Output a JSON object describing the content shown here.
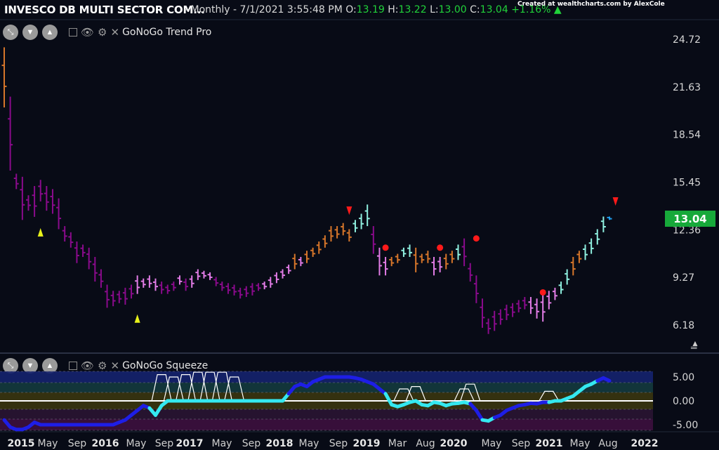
{
  "header": {
    "symbol_title": "INVESCO DB MULTI SECTOR COM...",
    "period": "- Monthly - 7/1/2021 3:55:48 PM",
    "ohlc": [
      {
        "label": "O:",
        "value": "13.19"
      },
      {
        "label": "H:",
        "value": "13.22"
      },
      {
        "label": "L:",
        "value": "13.00"
      },
      {
        "label": "C:",
        "value": "13.04"
      }
    ],
    "change": "+1.16%",
    "credit": "Created at wealthcharts.com by AlexCole"
  },
  "panels": {
    "trend": {
      "name": "GoNoGo Trend Pro"
    },
    "squeeze": {
      "name": "GoNoGo Squeeze"
    }
  },
  "icons": {
    "expand": "diagonal-arrows-icon",
    "down": "triangle-down-icon",
    "up": "triangle-up-icon",
    "visibility": "eye-icon",
    "settings": "gear-icon",
    "remove": "close-icon"
  },
  "colors": {
    "background": "#080b16",
    "nogo_strong": "#8a0b8c",
    "nogo_weak": "#e27ce6",
    "go_strong": "#d7762a",
    "go_weak": "#8ff0e0",
    "go_bright": "#1f9ff0",
    "signal_up": "#e8f21a",
    "signal_down": "#ff1a1a",
    "price_tag": "#17a93a"
  },
  "price_tag": "13.04",
  "chart_data": [
    {
      "type": "bar",
      "title": "GoNoGo Trend Pro",
      "y_ticks": [
        "24.72",
        "21.63",
        "18.54",
        "15.45",
        "12.36",
        "9.27",
        "6.18"
      ],
      "ylim": [
        4.2,
        26.7
      ],
      "x_ticks": [
        {
          "label": "2015",
          "bold": true
        },
        {
          "label": "May"
        },
        {
          "label": "Sep"
        },
        {
          "label": "2016",
          "bold": true
        },
        {
          "label": "May"
        },
        {
          "label": "Sep"
        },
        {
          "label": "2017",
          "bold": true
        },
        {
          "label": "May"
        },
        {
          "label": "Sep"
        },
        {
          "label": "2018",
          "bold": true
        },
        {
          "label": "May"
        },
        {
          "label": "Sep"
        },
        {
          "label": "2019",
          "bold": true
        },
        {
          "label": "Mar"
        },
        {
          "label": "Aug"
        },
        {
          "label": "2020",
          "bold": true
        },
        {
          "label": "May"
        },
        {
          "label": "Sep"
        },
        {
          "label": "2021",
          "bold": true
        },
        {
          "label": "May"
        },
        {
          "label": "Aug"
        },
        {
          "label": "2022",
          "bold": true
        }
      ],
      "x_range_months": [
        0,
        90
      ],
      "ohlc_bars": [
        {
          "m": 0,
          "h": 24.2,
          "l": 20.3,
          "c": "gs"
        },
        {
          "m": 1,
          "h": 21.0,
          "l": 16.2,
          "c": "ns"
        },
        {
          "m": 2,
          "h": 16.0,
          "l": 15.0,
          "c": "ns"
        },
        {
          "m": 3,
          "h": 15.8,
          "l": 13.0,
          "c": "ns"
        },
        {
          "m": 4,
          "h": 14.6,
          "l": 13.6,
          "c": "ns"
        },
        {
          "m": 5,
          "h": 15.2,
          "l": 13.2,
          "c": "ns"
        },
        {
          "m": 6,
          "h": 15.6,
          "l": 14.2,
          "c": "ns"
        },
        {
          "m": 7,
          "h": 15.2,
          "l": 13.6,
          "c": "ns"
        },
        {
          "m": 8,
          "h": 15.0,
          "l": 13.4,
          "c": "ns"
        },
        {
          "m": 9,
          "h": 14.4,
          "l": 12.4,
          "c": "ns"
        },
        {
          "m": 10,
          "h": 12.6,
          "l": 11.6,
          "c": "ns"
        },
        {
          "m": 11,
          "h": 12.2,
          "l": 11.2,
          "c": "ns"
        },
        {
          "m": 12,
          "h": 11.6,
          "l": 10.2,
          "c": "ns"
        },
        {
          "m": 13,
          "h": 11.4,
          "l": 10.6,
          "c": "ns"
        },
        {
          "m": 14,
          "h": 11.2,
          "l": 9.8,
          "c": "ns"
        },
        {
          "m": 15,
          "h": 10.6,
          "l": 9.0,
          "c": "ns"
        },
        {
          "m": 16,
          "h": 9.8,
          "l": 8.6,
          "c": "ns"
        },
        {
          "m": 17,
          "h": 8.8,
          "l": 7.3,
          "c": "ns"
        },
        {
          "m": 18,
          "h": 8.4,
          "l": 7.4,
          "c": "ns"
        },
        {
          "m": 19,
          "h": 8.4,
          "l": 7.6,
          "c": "ns"
        },
        {
          "m": 20,
          "h": 8.6,
          "l": 7.5,
          "c": "ns"
        },
        {
          "m": 21,
          "h": 8.8,
          "l": 7.9,
          "c": "ns"
        },
        {
          "m": 22,
          "h": 9.4,
          "l": 8.2,
          "c": "nw"
        },
        {
          "m": 23,
          "h": 9.2,
          "l": 8.6,
          "c": "nw"
        },
        {
          "m": 24,
          "h": 9.4,
          "l": 8.6,
          "c": "nw"
        },
        {
          "m": 25,
          "h": 9.2,
          "l": 8.4,
          "c": "nw"
        },
        {
          "m": 26,
          "h": 9.0,
          "l": 8.2,
          "c": "ns"
        },
        {
          "m": 27,
          "h": 8.8,
          "l": 8.2,
          "c": "ns"
        },
        {
          "m": 28,
          "h": 9.0,
          "l": 8.4,
          "c": "ns"
        },
        {
          "m": 29,
          "h": 9.4,
          "l": 8.8,
          "c": "nw"
        },
        {
          "m": 30,
          "h": 9.2,
          "l": 8.4,
          "c": "ns"
        },
        {
          "m": 31,
          "h": 9.4,
          "l": 8.6,
          "c": "nw"
        },
        {
          "m": 32,
          "h": 9.8,
          "l": 9.1,
          "c": "nw"
        },
        {
          "m": 33,
          "h": 9.7,
          "l": 9.2,
          "c": "nw"
        },
        {
          "m": 34,
          "h": 9.6,
          "l": 9.1,
          "c": "nw"
        },
        {
          "m": 35,
          "h": 9.3,
          "l": 8.7,
          "c": "ns"
        },
        {
          "m": 36,
          "h": 9.0,
          "l": 8.4,
          "c": "ns"
        },
        {
          "m": 37,
          "h": 8.9,
          "l": 8.2,
          "c": "ns"
        },
        {
          "m": 38,
          "h": 8.8,
          "l": 8.1,
          "c": "ns"
        },
        {
          "m": 39,
          "h": 8.6,
          "l": 7.9,
          "c": "ns"
        },
        {
          "m": 40,
          "h": 8.7,
          "l": 8.0,
          "c": "ns"
        },
        {
          "m": 41,
          "h": 8.9,
          "l": 8.1,
          "c": "ns"
        },
        {
          "m": 42,
          "h": 8.9,
          "l": 8.4,
          "c": "ns"
        },
        {
          "m": 43,
          "h": 9.0,
          "l": 8.5,
          "c": "nw"
        },
        {
          "m": 44,
          "h": 9.3,
          "l": 8.6,
          "c": "nw"
        },
        {
          "m": 45,
          "h": 9.6,
          "l": 8.9,
          "c": "nw"
        },
        {
          "m": 46,
          "h": 9.8,
          "l": 9.2,
          "c": "nw"
        },
        {
          "m": 47,
          "h": 10.1,
          "l": 9.5,
          "c": "nw"
        },
        {
          "m": 48,
          "h": 10.8,
          "l": 9.8,
          "c": "gs"
        },
        {
          "m": 49,
          "h": 10.6,
          "l": 10.0,
          "c": "nw"
        },
        {
          "m": 50,
          "h": 11.0,
          "l": 10.2,
          "c": "gs"
        },
        {
          "m": 51,
          "h": 11.2,
          "l": 10.6,
          "c": "gs"
        },
        {
          "m": 52,
          "h": 11.6,
          "l": 10.8,
          "c": "gs"
        },
        {
          "m": 53,
          "h": 12.0,
          "l": 11.2,
          "c": "gs"
        },
        {
          "m": 54,
          "h": 12.6,
          "l": 11.6,
          "c": "gs"
        },
        {
          "m": 55,
          "h": 12.6,
          "l": 11.8,
          "c": "gs"
        },
        {
          "m": 56,
          "h": 12.8,
          "l": 12.0,
          "c": "gs"
        },
        {
          "m": 57,
          "h": 12.4,
          "l": 11.6,
          "c": "gs"
        },
        {
          "m": 58,
          "h": 13.0,
          "l": 12.2,
          "c": "gw"
        },
        {
          "m": 59,
          "h": 13.4,
          "l": 12.4,
          "c": "gw"
        },
        {
          "m": 60,
          "h": 14.0,
          "l": 12.6,
          "c": "gw"
        },
        {
          "m": 61,
          "h": 12.6,
          "l": 10.8,
          "c": "ns"
        },
        {
          "m": 62,
          "h": 11.2,
          "l": 9.4,
          "c": "nw"
        },
        {
          "m": 63,
          "h": 10.6,
          "l": 9.4,
          "c": "nw"
        },
        {
          "m": 64,
          "h": 10.6,
          "l": 10.0,
          "c": "gs"
        },
        {
          "m": 65,
          "h": 10.8,
          "l": 10.2,
          "c": "gs"
        },
        {
          "m": 66,
          "h": 11.2,
          "l": 10.6,
          "c": "gw"
        },
        {
          "m": 67,
          "h": 11.4,
          "l": 10.6,
          "c": "gw"
        },
        {
          "m": 68,
          "h": 11.2,
          "l": 9.6,
          "c": "gs"
        },
        {
          "m": 69,
          "h": 10.8,
          "l": 10.2,
          "c": "gs"
        },
        {
          "m": 70,
          "h": 11.0,
          "l": 10.2,
          "c": "gs"
        },
        {
          "m": 71,
          "h": 10.6,
          "l": 9.4,
          "c": "nw"
        },
        {
          "m": 72,
          "h": 10.6,
          "l": 9.6,
          "c": "nw"
        },
        {
          "m": 73,
          "h": 10.8,
          "l": 9.8,
          "c": "gs"
        },
        {
          "m": 74,
          "h": 11.0,
          "l": 10.2,
          "c": "gs"
        },
        {
          "m": 75,
          "h": 11.4,
          "l": 10.4,
          "c": "gw"
        },
        {
          "m": 76,
          "h": 11.8,
          "l": 10.0,
          "c": "ns"
        },
        {
          "m": 77,
          "h": 10.2,
          "l": 9.0,
          "c": "ns"
        },
        {
          "m": 78,
          "h": 9.4,
          "l": 7.6,
          "c": "ns"
        },
        {
          "m": 79,
          "h": 7.9,
          "l": 6.0,
          "c": "ns"
        },
        {
          "m": 80,
          "h": 6.6,
          "l": 5.6,
          "c": "ns"
        },
        {
          "m": 81,
          "h": 7.1,
          "l": 5.8,
          "c": "ns"
        },
        {
          "m": 82,
          "h": 7.2,
          "l": 6.2,
          "c": "ns"
        },
        {
          "m": 83,
          "h": 7.5,
          "l": 6.5,
          "c": "ns"
        },
        {
          "m": 84,
          "h": 7.6,
          "l": 6.7,
          "c": "ns"
        },
        {
          "m": 85,
          "h": 7.8,
          "l": 7.0,
          "c": "ns"
        },
        {
          "m": 86,
          "h": 8.0,
          "l": 7.2,
          "c": "ns"
        },
        {
          "m": 87,
          "h": 8.0,
          "l": 6.9,
          "c": "nw"
        },
        {
          "m": 88,
          "h": 7.9,
          "l": 6.6,
          "c": "nw"
        },
        {
          "m": 89,
          "h": 8.2,
          "l": 6.4,
          "c": "nw"
        },
        {
          "m": 90,
          "h": 8.4,
          "l": 7.2,
          "c": "nw"
        },
        {
          "m": 91,
          "h": 8.6,
          "l": 7.8,
          "c": "nw"
        },
        {
          "m": 92,
          "h": 9.0,
          "l": 8.2,
          "c": "gw"
        },
        {
          "m": 93,
          "h": 9.8,
          "l": 8.8,
          "c": "gw"
        },
        {
          "m": 94,
          "h": 10.6,
          "l": 9.4,
          "c": "gs"
        },
        {
          "m": 95,
          "h": 11.0,
          "l": 10.2,
          "c": "gs"
        },
        {
          "m": 96,
          "h": 11.4,
          "l": 10.4,
          "c": "gw"
        },
        {
          "m": 97,
          "h": 11.8,
          "l": 10.8,
          "c": "gw"
        },
        {
          "m": 98,
          "h": 12.4,
          "l": 11.4,
          "c": "gw"
        },
        {
          "m": 99,
          "h": 13.22,
          "l": 12.2,
          "c": "gw"
        },
        {
          "m": 100,
          "h": 13.22,
          "l": 13.0,
          "c": "gb"
        }
      ],
      "signals": [
        {
          "m": 6,
          "v": 12.2,
          "type": "up-triangle"
        },
        {
          "m": 22,
          "v": 6.6,
          "type": "up-triangle"
        },
        {
          "m": 57,
          "v": 13.6,
          "type": "down-triangle"
        },
        {
          "m": 63,
          "v": 11.2,
          "type": "dot"
        },
        {
          "m": 72,
          "v": 11.2,
          "type": "dot"
        },
        {
          "m": 78,
          "v": 11.8,
          "type": "dot"
        },
        {
          "m": 89,
          "v": 8.3,
          "type": "dot"
        },
        {
          "m": 101,
          "v": 14.2,
          "type": "down-triangle"
        }
      ]
    },
    {
      "type": "line",
      "title": "GoNoGo Squeeze",
      "y_ticks": [
        "5.00",
        "0.00",
        "-5.00"
      ],
      "ylim": [
        -6.5,
        6.5
      ],
      "series": [
        {
          "name": "GoNoGo Squeeze",
          "x": [
            0,
            1,
            2,
            3,
            4,
            5,
            6,
            7,
            8,
            9,
            10,
            11,
            12,
            13,
            14,
            15,
            16,
            17,
            18,
            19,
            20,
            21,
            22,
            23,
            24,
            25,
            26,
            27,
            28,
            29,
            30,
            31,
            32,
            33,
            34,
            35,
            36,
            37,
            38,
            39,
            40,
            41,
            42,
            43,
            44,
            45,
            46,
            47,
            48,
            49,
            50,
            51,
            52,
            53,
            54,
            55,
            56,
            57,
            58,
            59,
            60,
            61,
            62,
            63,
            64,
            65,
            66,
            67,
            68,
            69,
            70,
            71,
            72,
            73,
            74,
            75,
            76,
            77,
            78,
            79,
            80,
            81,
            82,
            83,
            84,
            85,
            86,
            87,
            88,
            89,
            90,
            91,
            92,
            93,
            94,
            95,
            96,
            97,
            98,
            99,
            100
          ],
          "values": [
            -4.0,
            -5.5,
            -6.0,
            -6.0,
            -5.5,
            -4.5,
            -5.0,
            -5.0,
            -5.0,
            -5.0,
            -5.0,
            -5.0,
            -5.0,
            -5.0,
            -5.0,
            -5.0,
            -5.0,
            -5.0,
            -5.0,
            -4.5,
            -4.0,
            -3.0,
            -2.0,
            -1.0,
            -1.5,
            -3.0,
            -1.0,
            0.0,
            0.0,
            0.0,
            0.0,
            0.0,
            0.0,
            0.0,
            0.0,
            0.0,
            0.0,
            0.0,
            0.0,
            0.0,
            0.0,
            0.0,
            0.0,
            0.0,
            0.0,
            0.0,
            0.0,
            1.5,
            3.0,
            3.5,
            3.0,
            4.0,
            4.5,
            5.0,
            5.0,
            5.0,
            5.0,
            5.0,
            4.8,
            4.5,
            4.0,
            3.5,
            2.5,
            1.5,
            -0.8,
            -1.2,
            -0.8,
            -0.3,
            0.0,
            -0.8,
            -1.0,
            -0.3,
            -0.5,
            -1.0,
            -0.6,
            -0.5,
            -0.3,
            -0.6,
            -2.0,
            -4.0,
            -4.2,
            -3.5,
            -3.0,
            -2.0,
            -1.5,
            -1.0,
            -0.8,
            -0.5,
            -0.6,
            -0.3,
            -0.3,
            0.0,
            0.0,
            0.5,
            1.0,
            2.0,
            3.0,
            3.5,
            4.2,
            4.8,
            4.2
          ]
        }
      ],
      "squeeze_peaks": [
        {
          "m": 26,
          "v": 5.5
        },
        {
          "m": 28,
          "v": 5.0
        },
        {
          "m": 30,
          "v": 5.5
        },
        {
          "m": 32,
          "v": 6.0
        },
        {
          "m": 34,
          "v": 6.0
        },
        {
          "m": 36,
          "v": 6.0
        },
        {
          "m": 38,
          "v": 5.0
        },
        {
          "m": 66,
          "v": 2.5
        },
        {
          "m": 68,
          "v": 3.0
        },
        {
          "m": 76,
          "v": 2.5
        },
        {
          "m": 77,
          "v": 3.5
        },
        {
          "m": 90,
          "v": 2.0
        }
      ]
    }
  ]
}
